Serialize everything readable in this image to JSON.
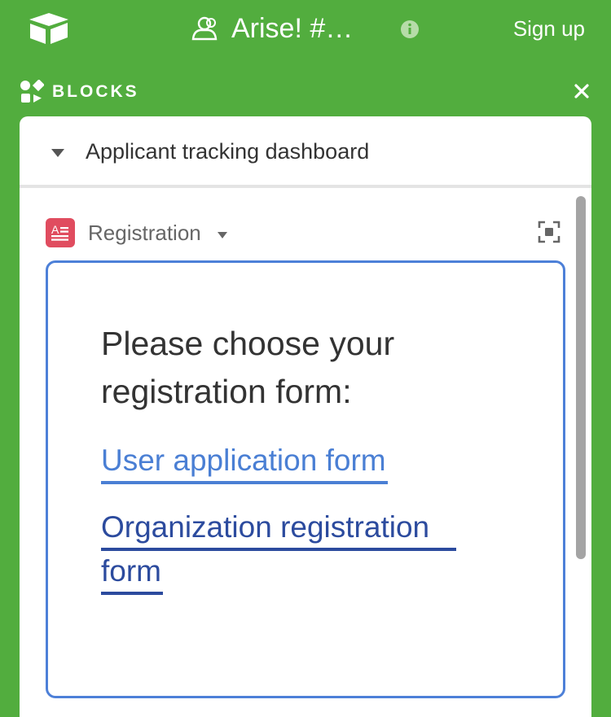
{
  "header": {
    "app": "airtable",
    "title": "Arise! #…",
    "signup_label": "Sign up",
    "icons": [
      "logo-icon",
      "user-icon",
      "info-icon"
    ]
  },
  "blocks": {
    "label": "BLOCKS",
    "icons": [
      "blocks-icon",
      "close-icon"
    ]
  },
  "dashboard": {
    "title": "Applicant tracking dashboard"
  },
  "block": {
    "name": "Registration",
    "prompt": "Please choose your registration form:",
    "links": [
      {
        "label": "User application form"
      },
      {
        "label_line1": "Organization registration",
        "label_line2": "form"
      }
    ]
  },
  "colors": {
    "background": "#52ad3e",
    "panel": "#ffffff",
    "accent": "#4d80d8",
    "link_user": "#4a7fd4",
    "link_org": "#2c4b9e",
    "block_icon": "#e04c5f"
  }
}
